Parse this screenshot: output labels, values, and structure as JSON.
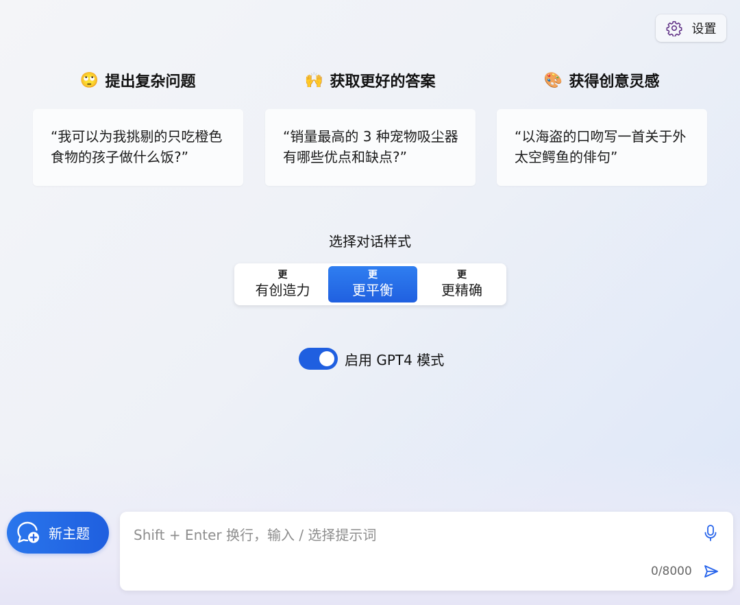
{
  "header": {
    "settings_label": "设置",
    "settings_icon": "gear-icon"
  },
  "features": [
    {
      "emoji": "🙄",
      "icon": "face-with-rolling-eyes-icon",
      "title": "提出复杂问题",
      "prompt": "“我可以为我挑剔的只吃橙色食物的孩子做什么饭?”"
    },
    {
      "emoji": "🙌",
      "icon": "raising-hands-icon",
      "title": "获取更好的答案",
      "prompt": "“销量最高的 3 种宠物吸尘器有哪些优点和缺点?”"
    },
    {
      "emoji": "🎨",
      "icon": "artist-palette-icon",
      "title": "获得创意灵感",
      "prompt": "“以海盗的口吻写一首关于外太空鳄鱼的俳句”"
    }
  ],
  "conversation_style": {
    "heading": "选择对话样式",
    "options": [
      {
        "top": "更",
        "label": "有创造力",
        "active": false
      },
      {
        "top": "更",
        "label": "更平衡",
        "active": true
      },
      {
        "top": "更",
        "label": "更精确",
        "active": false
      }
    ],
    "accent_color": "#2563eb"
  },
  "gpt4_toggle": {
    "label": "启用 GPT4 模式",
    "enabled": true
  },
  "composer": {
    "new_topic_label": "新主题",
    "new_topic_icon": "chat-add-icon",
    "placeholder": "Shift + Enter 换行，输入 / 选择提示词",
    "char_count": "0/8000",
    "mic_icon": "microphone-icon",
    "send_icon": "send-icon"
  }
}
